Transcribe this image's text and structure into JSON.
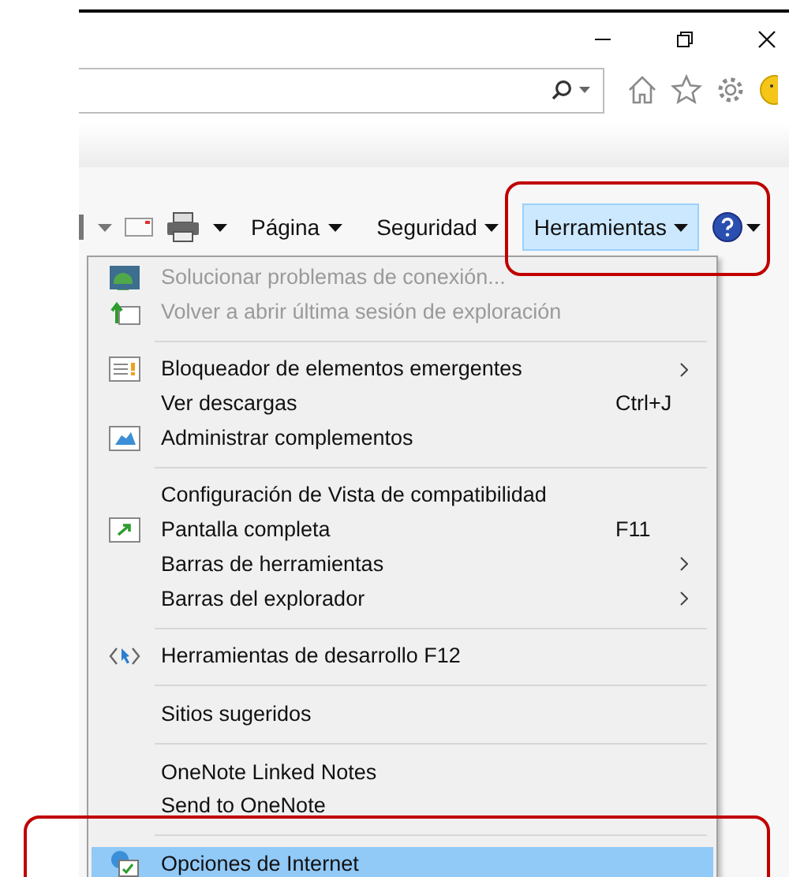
{
  "toolbar": {
    "buttons": [
      {
        "label": "Página",
        "selected": false
      },
      {
        "label": "Seguridad",
        "selected": false
      },
      {
        "label": "Herramientas",
        "selected": true
      }
    ]
  },
  "menu": {
    "items": [
      {
        "kind": "item",
        "label": "Solucionar problemas de conexión...",
        "disabled": true,
        "selected": false
      },
      {
        "kind": "item",
        "label": "Volver a abrir última sesión de exploración",
        "disabled": true,
        "selected": false
      },
      {
        "kind": "separator"
      },
      {
        "kind": "item",
        "label": "Bloqueador de elementos emergentes",
        "disabled": false,
        "selected": false,
        "submenu": true
      },
      {
        "kind": "item",
        "label": "Ver descargas",
        "disabled": false,
        "selected": false,
        "shortcut": "Ctrl+J"
      },
      {
        "kind": "item",
        "label": "Administrar complementos",
        "disabled": false,
        "selected": false
      },
      {
        "kind": "separator"
      },
      {
        "kind": "item",
        "label": "Configuración de Vista de compatibilidad",
        "disabled": false,
        "selected": false
      },
      {
        "kind": "item",
        "label": "Pantalla completa",
        "disabled": false,
        "selected": false,
        "shortcut": "F11"
      },
      {
        "kind": "item",
        "label": "Barras de herramientas",
        "disabled": false,
        "selected": false,
        "submenu": true
      },
      {
        "kind": "item",
        "label": "Barras del explorador",
        "disabled": false,
        "selected": false,
        "submenu": true
      },
      {
        "kind": "separator"
      },
      {
        "kind": "item",
        "label": "Herramientas de desarrollo F12",
        "disabled": false,
        "selected": false
      },
      {
        "kind": "separator"
      },
      {
        "kind": "item",
        "label": "Sitios sugeridos",
        "disabled": false,
        "selected": false
      },
      {
        "kind": "separator"
      },
      {
        "kind": "item",
        "label": "OneNote Linked Notes",
        "disabled": false,
        "selected": false
      },
      {
        "kind": "item",
        "label": "Send to OneNote",
        "disabled": false,
        "selected": false
      },
      {
        "kind": "separator"
      },
      {
        "kind": "item",
        "label": "Opciones de Internet",
        "disabled": false,
        "selected": true
      }
    ]
  }
}
